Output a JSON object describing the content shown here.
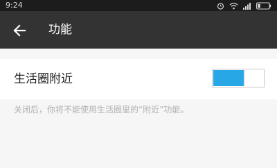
{
  "status_bar": {
    "time": "9:24",
    "icons": [
      "alarm-icon",
      "wifi-icon",
      "signal-icon",
      "battery-icon"
    ]
  },
  "app_bar": {
    "back_icon": "back-arrow-icon",
    "title": "功能"
  },
  "setting": {
    "label": "生活圈附近",
    "enabled": true,
    "accent_color": "#27a7e6",
    "hint": "关闭后，你将不能使用生活圈里的“附近”功能。"
  }
}
